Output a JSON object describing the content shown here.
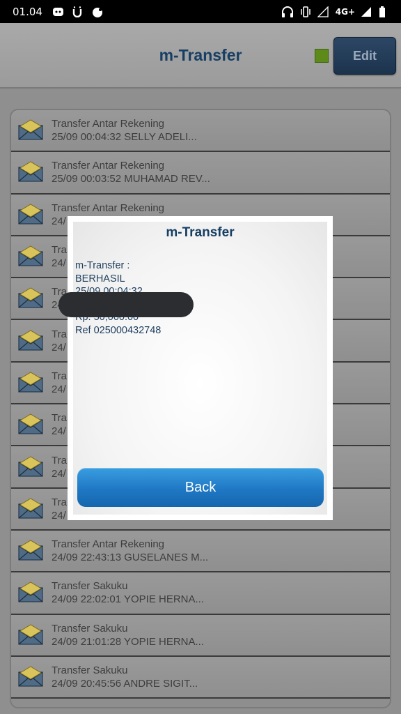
{
  "status_bar": {
    "time": "01.04",
    "network": "4G+"
  },
  "header": {
    "title": "m-Transfer",
    "edit_label": "Edit"
  },
  "transactions": [
    {
      "title": "Transfer Antar Rekening",
      "sub": "25/09 00:04:32 SELLY ADELI..."
    },
    {
      "title": "Transfer Antar Rekening",
      "sub": "25/09 00:03:52 MUHAMAD REV..."
    },
    {
      "title": "Transfer Antar Rekening",
      "sub": "24/"
    },
    {
      "title": "Tran",
      "sub": "24/"
    },
    {
      "title": "Tran",
      "sub": "24/"
    },
    {
      "title": "Tran",
      "sub": "24/"
    },
    {
      "title": "Tran",
      "sub": "24/"
    },
    {
      "title": "Tran",
      "sub": "24/"
    },
    {
      "title": "Tran",
      "sub": "24/"
    },
    {
      "title": "Tran",
      "sub": "24/"
    },
    {
      "title": "Transfer Antar Rekening",
      "sub": "24/09 22:43:13 GUSELANES M..."
    },
    {
      "title": "Transfer Sakuku",
      "sub": "24/09 22:02:01 YOPIE HERNA..."
    },
    {
      "title": "Transfer Sakuku",
      "sub": "24/09 21:01:28 YOPIE HERNA..."
    },
    {
      "title": "Transfer Sakuku",
      "sub": "24/09 20:45:56 ANDRE SIGIT..."
    }
  ],
  "dialog": {
    "title": "m-Transfer",
    "line1": "m-Transfer :",
    "line2": "BERHASIL",
    "line3": "25/09 00:04:32",
    "amount": "Rp. 50,000.00",
    "ref": "Ref 025000432748",
    "back_label": "Back"
  },
  "colors": {
    "accent": "#173e63",
    "button": "#1f78c4"
  }
}
